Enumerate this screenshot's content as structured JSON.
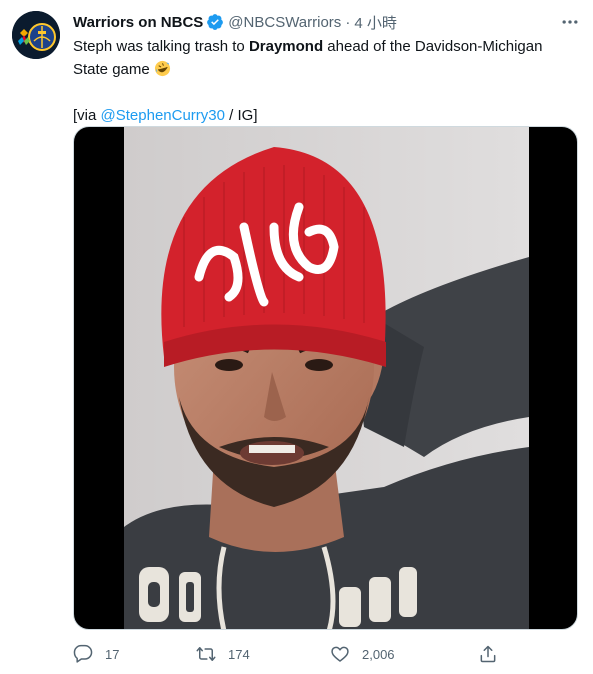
{
  "tweet": {
    "display_name": "Warriors on NBCS",
    "verified_icon": "verified-badge-icon",
    "handle": "@NBCSWarriors",
    "separator": "·",
    "time": "4 小時",
    "text_before": "Steph was talking trash to ",
    "text_bold": "Draymond",
    "text_after": " ahead of the Davidson-Michigan State game ",
    "emoji": "rolling-on-floor-laughing-emoji",
    "via_prefix": "[via ",
    "via_link": "@StephenCurry30",
    "via_suffix": " / IG]"
  },
  "actions": {
    "replies": "17",
    "retweets": "174",
    "likes": "2,006"
  },
  "colors": {
    "link": "#1d9bf0",
    "secondary": "#536471",
    "verified": "#1d9bf0",
    "text": "#0f1419"
  }
}
